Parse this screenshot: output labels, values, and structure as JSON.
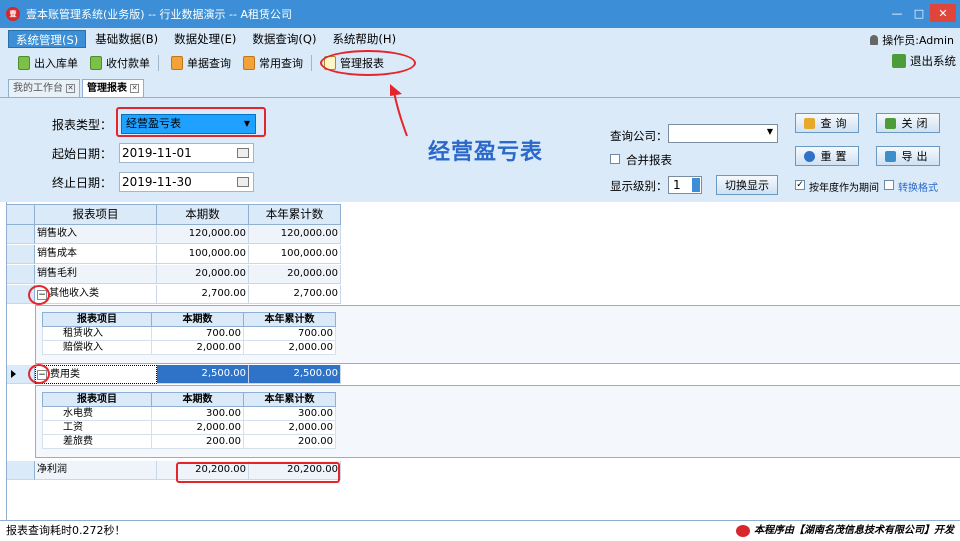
{
  "window": {
    "title": "壹本账管理系统(业务版) -- 行业数据演示 -- A租赁公司"
  },
  "menu": {
    "items": [
      "系统管理(S)",
      "基础数据(B)",
      "数据处理(E)",
      "数据查询(Q)",
      "系统帮助(H)"
    ],
    "operator": "操作员:Admin"
  },
  "toolbar": {
    "items": [
      "出入库单",
      "收付款单",
      "单据查询",
      "常用查询",
      "管理报表"
    ],
    "exit": "退出系统"
  },
  "tabs": [
    "我的工作台",
    "管理报表"
  ],
  "form": {
    "report_type_label": "报表类型：",
    "report_type_value": "经营盈亏表",
    "start_label": "起始日期：",
    "start_value": "2019-11-01",
    "end_label": "终止日期：",
    "end_value": "2019-11-30",
    "big_title": "经营盈亏表",
    "company_label": "查询公司：",
    "company_value": "",
    "merge_label": "合并报表",
    "level_label": "显示级别：",
    "level_value": "1",
    "switch_btn": "切换显示",
    "year_period_label": "按年度作为期间",
    "year_period_checked": true,
    "convert_label": "转换格式",
    "btn_query": "查询",
    "btn_close": "关闭",
    "btn_reset": "重置",
    "btn_export": "导出"
  },
  "grid": {
    "headers": [
      "报表项目",
      "本期数",
      "本年累计数"
    ],
    "rows": [
      {
        "name": "销售收入",
        "current": "120,000.00",
        "ytd": "120,000.00"
      },
      {
        "name": "销售成本",
        "current": "100,000.00",
        "ytd": "100,000.00"
      },
      {
        "name": "销售毛利",
        "current": "20,000.00",
        "ytd": "20,000.00"
      },
      {
        "name": "其他收入类",
        "current": "2,700.00",
        "ytd": "2,700.00"
      },
      {
        "name": "费用类",
        "current": "2,500.00",
        "ytd": "2,500.00"
      },
      {
        "name": "净利润",
        "current": "20,200.00",
        "ytd": "20,200.00"
      }
    ],
    "other_income_detail": [
      {
        "name": "租赁收入",
        "current": "700.00",
        "ytd": "700.00"
      },
      {
        "name": "赔偿收入",
        "current": "2,000.00",
        "ytd": "2,000.00"
      }
    ],
    "expense_detail": [
      {
        "name": "水电费",
        "current": "300.00",
        "ytd": "300.00"
      },
      {
        "name": "工资",
        "current": "2,000.00",
        "ytd": "2,000.00"
      },
      {
        "name": "差旅费",
        "current": "200.00",
        "ytd": "200.00"
      }
    ]
  },
  "status": {
    "left": "报表查询耗时0.272秒！",
    "right": "本程序由【湖南名茂信息技术有限公司】开发"
  },
  "colors": {
    "titlebar": "#3c8fd6",
    "panel": "#dbeaf8",
    "accent_title": "#2a69c9",
    "annotation": "#e4262c"
  }
}
